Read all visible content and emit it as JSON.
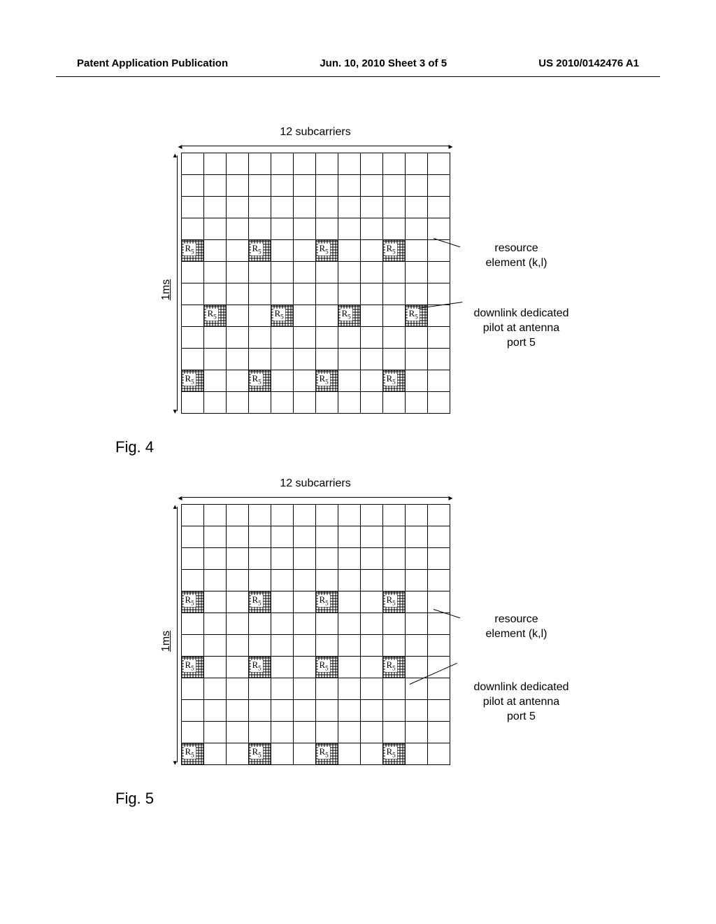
{
  "header": {
    "left": "Patent Application Publication",
    "center": "Jun. 10, 2010  Sheet 3 of 5",
    "right": "US 2010/0142476 A1"
  },
  "common": {
    "top_label": "12 subcarriers",
    "left_label": "1ms",
    "annot_resource_l1": "resource",
    "annot_resource_l2": "element  (k,l)",
    "annot_pilot_l1": "downlink dedicated",
    "annot_pilot_l2": "pilot at antenna",
    "annot_pilot_l3": "port 5",
    "pilot_symbol": "R",
    "pilot_sub": "5"
  },
  "fig4": {
    "caption": "Fig. 4",
    "rows": 12,
    "cols": 12,
    "pilots": [
      [
        4,
        0
      ],
      [
        4,
        3
      ],
      [
        4,
        6
      ],
      [
        4,
        9
      ],
      [
        7,
        1
      ],
      [
        7,
        4
      ],
      [
        7,
        7
      ],
      [
        7,
        10
      ],
      [
        10,
        0
      ],
      [
        10,
        3
      ],
      [
        10,
        6
      ],
      [
        10,
        9
      ]
    ]
  },
  "fig5": {
    "caption": "Fig. 5",
    "rows": 12,
    "cols": 12,
    "pilots": [
      [
        4,
        0
      ],
      [
        4,
        3
      ],
      [
        4,
        6
      ],
      [
        4,
        9
      ],
      [
        7,
        0
      ],
      [
        7,
        3
      ],
      [
        7,
        6
      ],
      [
        7,
        9
      ],
      [
        11,
        0
      ],
      [
        11,
        3
      ],
      [
        11,
        6
      ],
      [
        11,
        9
      ]
    ]
  }
}
